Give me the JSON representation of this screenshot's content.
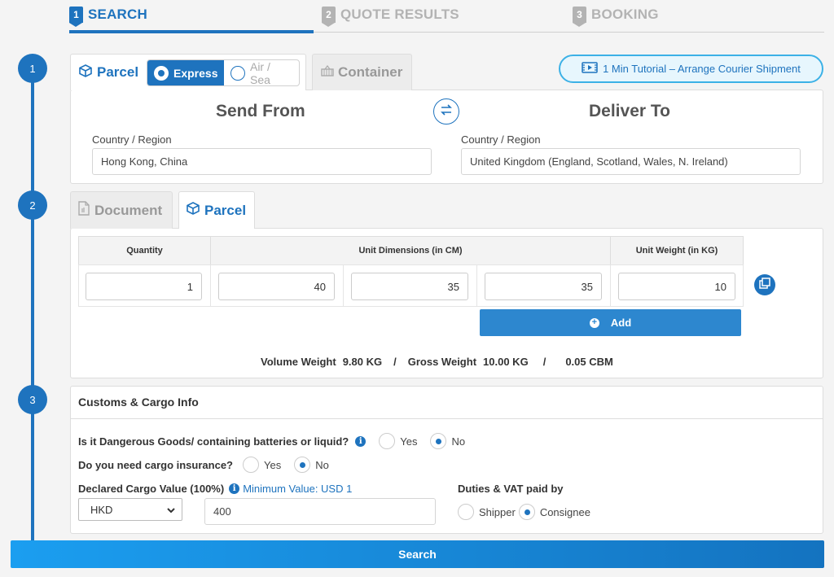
{
  "steps": [
    {
      "num": "1",
      "label": "SEARCH"
    },
    {
      "num": "2",
      "label": "QUOTE RESULTS"
    },
    {
      "num": "3",
      "label": "BOOKING"
    }
  ],
  "timeline": [
    "1",
    "2",
    "3"
  ],
  "section1": {
    "tab_parcel": "Parcel",
    "tab_container": "Container",
    "mode_express": "Express",
    "mode_airsea": "Air / Sea",
    "tutorial": "1 Min Tutorial – Arrange Courier Shipment",
    "send_from_title": "Send From",
    "deliver_to_title": "Deliver To",
    "from_label": "Country / Region",
    "from_value": "Hong Kong, China",
    "to_label": "Country / Region",
    "to_value": "United Kingdom (England, Scotland, Wales, N. Ireland)"
  },
  "section2": {
    "tab_document": "Document",
    "tab_parcel": "Parcel",
    "headers": {
      "quantity": "Quantity",
      "dimensions": "Unit Dimensions (in CM)",
      "weight": "Unit Weight (in KG)"
    },
    "row": {
      "quantity": "1",
      "length": "40",
      "width": "35",
      "height": "35",
      "weight": "10"
    },
    "add_label": "Add",
    "summary": {
      "volume_label": "Volume Weight",
      "volume_value": "9.80 KG",
      "sep1": "/",
      "gross_label": "Gross Weight",
      "gross_value": "10.00 KG",
      "sep2": "/",
      "cbm_value": "0.05 CBM"
    }
  },
  "section3": {
    "title": "Customs & Cargo Info",
    "dangerous_q": "Is it Dangerous Goods/ containing batteries or liquid?",
    "insurance_q": "Do you need cargo insurance?",
    "yes": "Yes",
    "no": "No",
    "declared_label": "Declared Cargo Value (100%)",
    "min_value": "Minimum Value: USD 1",
    "currency": "HKD",
    "declared_value": "400",
    "duties_label": "Duties & VAT paid by",
    "shipper": "Shipper",
    "consignee": "Consignee"
  },
  "search_label": "Search",
  "colors": {
    "primary": "#1e73be",
    "accent": "#3cb1e6"
  }
}
